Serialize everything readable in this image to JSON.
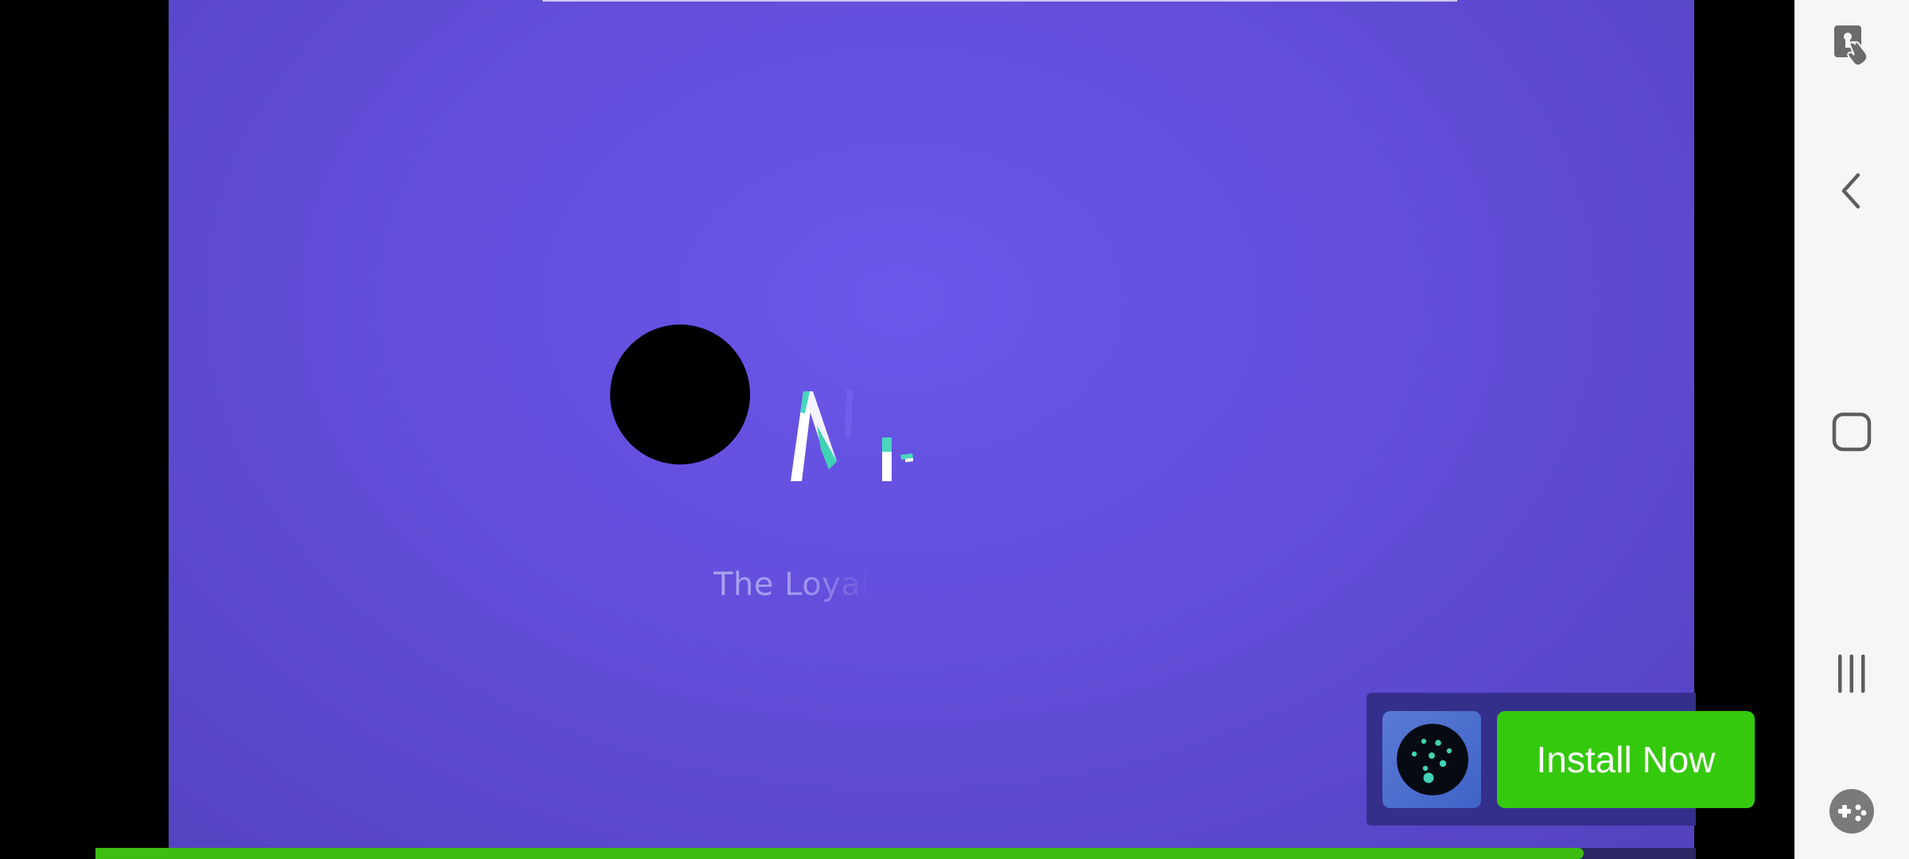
{
  "ad": {
    "tagline": "The Loyal",
    "logo_partial_text": "N"
  },
  "install_banner": {
    "button_label": "Install Now",
    "app_icon": "dotted-logo-icon"
  },
  "progress": {
    "fraction": 0.93
  },
  "nav_rail": {
    "items": [
      {
        "name": "touch-lock",
        "icon": "touch-protection-icon"
      },
      {
        "name": "back",
        "icon": "back-arrow-icon"
      },
      {
        "name": "home",
        "icon": "home-square-icon"
      },
      {
        "name": "recents",
        "icon": "recents-icon"
      },
      {
        "name": "game-tools",
        "icon": "game-controller-icon"
      }
    ]
  },
  "colors": {
    "background_purple": "#6553e2",
    "install_green": "#35c90d",
    "banner_dark": "#352f8c",
    "accent_teal": "#3fd3b5"
  }
}
